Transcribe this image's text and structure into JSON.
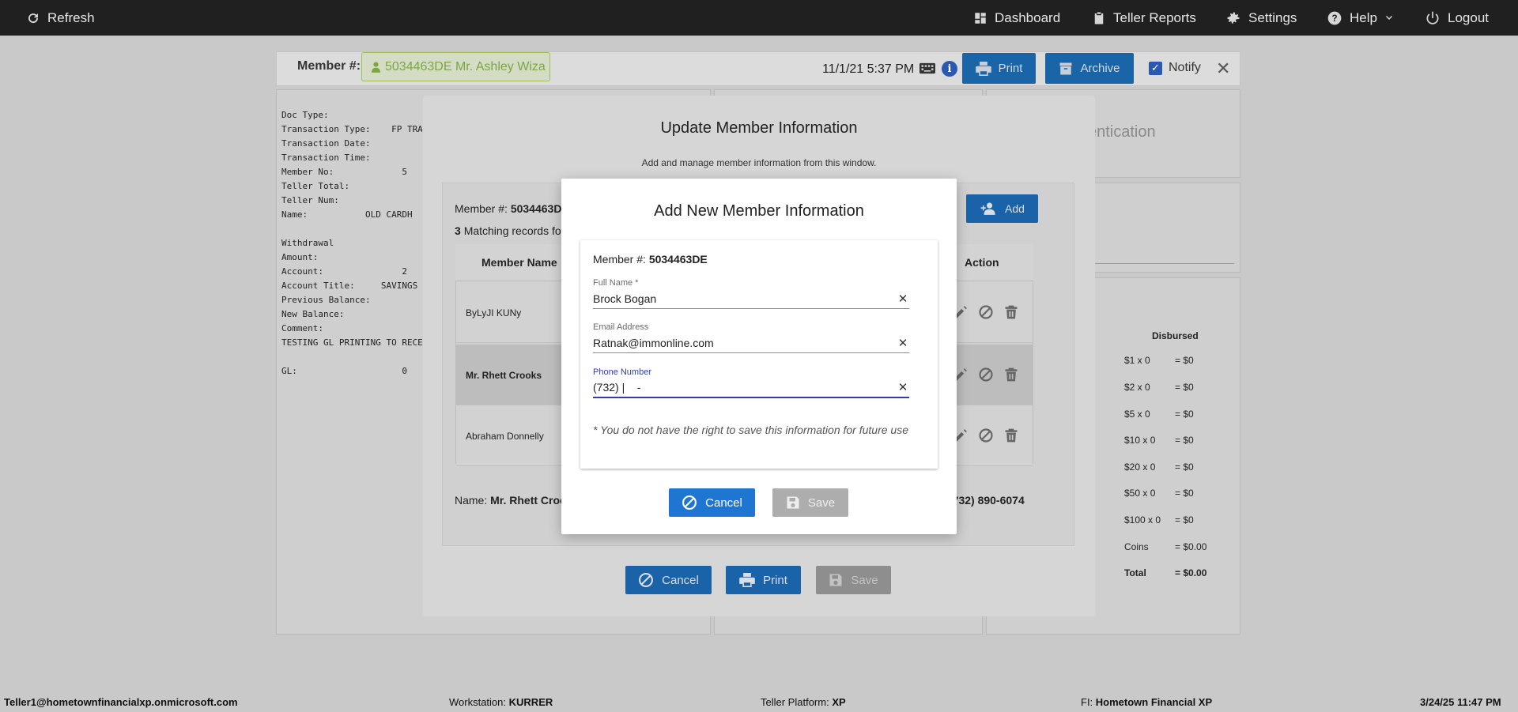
{
  "nav": {
    "refresh": "Refresh",
    "dashboard": "Dashboard",
    "teller_reports": "Teller Reports",
    "settings": "Settings",
    "help": "Help",
    "logout": "Logout"
  },
  "member_bar": {
    "label": "Member #:",
    "member_chip": "5034463DE Mr. Ashley Wiza",
    "datetime": "11/1/21 5:37 PM",
    "print": "Print",
    "archive": "Archive",
    "notify": "Notify"
  },
  "receipt_lines": [
    "Doc Type:",
    "Transaction Type:    FP TRA",
    "Transaction Date:",
    "Transaction Time:",
    "Member No:             5",
    "Teller Total:",
    "Teller Num:",
    "Name:           OLD CARDH",
    "",
    "Withdrawal",
    "Amount:",
    "Account:               2",
    "Account Title:     SAVINGS",
    "Previous Balance:",
    "New Balance:",
    "Comment:",
    "TESTING GL PRINTING TO RECE",
    "",
    "GL:                    0"
  ],
  "right_panel": {
    "ghost_heading": "entication",
    "disbursed_header": "Disbursed",
    "rows": [
      {
        "denom": "$1 x 0",
        "amount": "= $0"
      },
      {
        "denom": "$2 x 0",
        "amount": "= $0"
      },
      {
        "denom": "$5 x 0",
        "amount": "= $0"
      },
      {
        "denom": "$10 x 0",
        "amount": "= $0"
      },
      {
        "denom": "$20 x 0",
        "amount": "= $0"
      },
      {
        "denom": "$50 x 0",
        "amount": "= $0"
      },
      {
        "denom": "$100 x 0",
        "amount": "= $0"
      },
      {
        "denom": "Coins",
        "amount": "= $0.00"
      },
      {
        "denom": "Total",
        "amount": "= $0.00"
      }
    ]
  },
  "update_dialog": {
    "title": "Update Member Information",
    "subtitle": "Add and manage member information from this window.",
    "member_label": "Member #:",
    "member_value": "5034463D",
    "matching_count": "3",
    "matching_text": "Matching records fo",
    "add_label": "Add",
    "columns": [
      "Member Name",
      "Action"
    ],
    "rows": [
      {
        "name": "ByLyJI KUNy"
      },
      {
        "name": "Mr. Rhett Crooks"
      },
      {
        "name": "Abraham Donnelly"
      }
    ],
    "name_label": "Name:",
    "name_value": "Mr. Rhett Croc",
    "phone_value": "(732) 890-6074",
    "cancel": "Cancel",
    "print": "Print",
    "save": "Save"
  },
  "add_dialog": {
    "title": "Add New Member Information",
    "member_label": "Member #:",
    "member_value": "5034463DE",
    "full_name_label": "Full Name *",
    "full_name_value": "Brock Bogan",
    "email_label": "Email Address",
    "email_value": "Ratnak@immonline.com",
    "phone_label": "Phone Number",
    "phone_value": "(732) |    -",
    "note": "* You do not have the right to save this information for future use",
    "cancel": "Cancel",
    "save": "Save"
  },
  "footer": {
    "user": "Teller1@hometownfinancialxp.onmicrosoft.com",
    "workstation_label": "Workstation:",
    "workstation_value": "KURRER",
    "platform_label": "Teller Platform:",
    "platform_value": "XP",
    "fi_label": "FI:",
    "fi_value": "Hometown Financial XP",
    "timestamp": "3/24/25 11:47 PM"
  },
  "colors": {
    "primary": "#1f76d2",
    "nav_bg": "#202020",
    "focus": "#2b3fae"
  }
}
